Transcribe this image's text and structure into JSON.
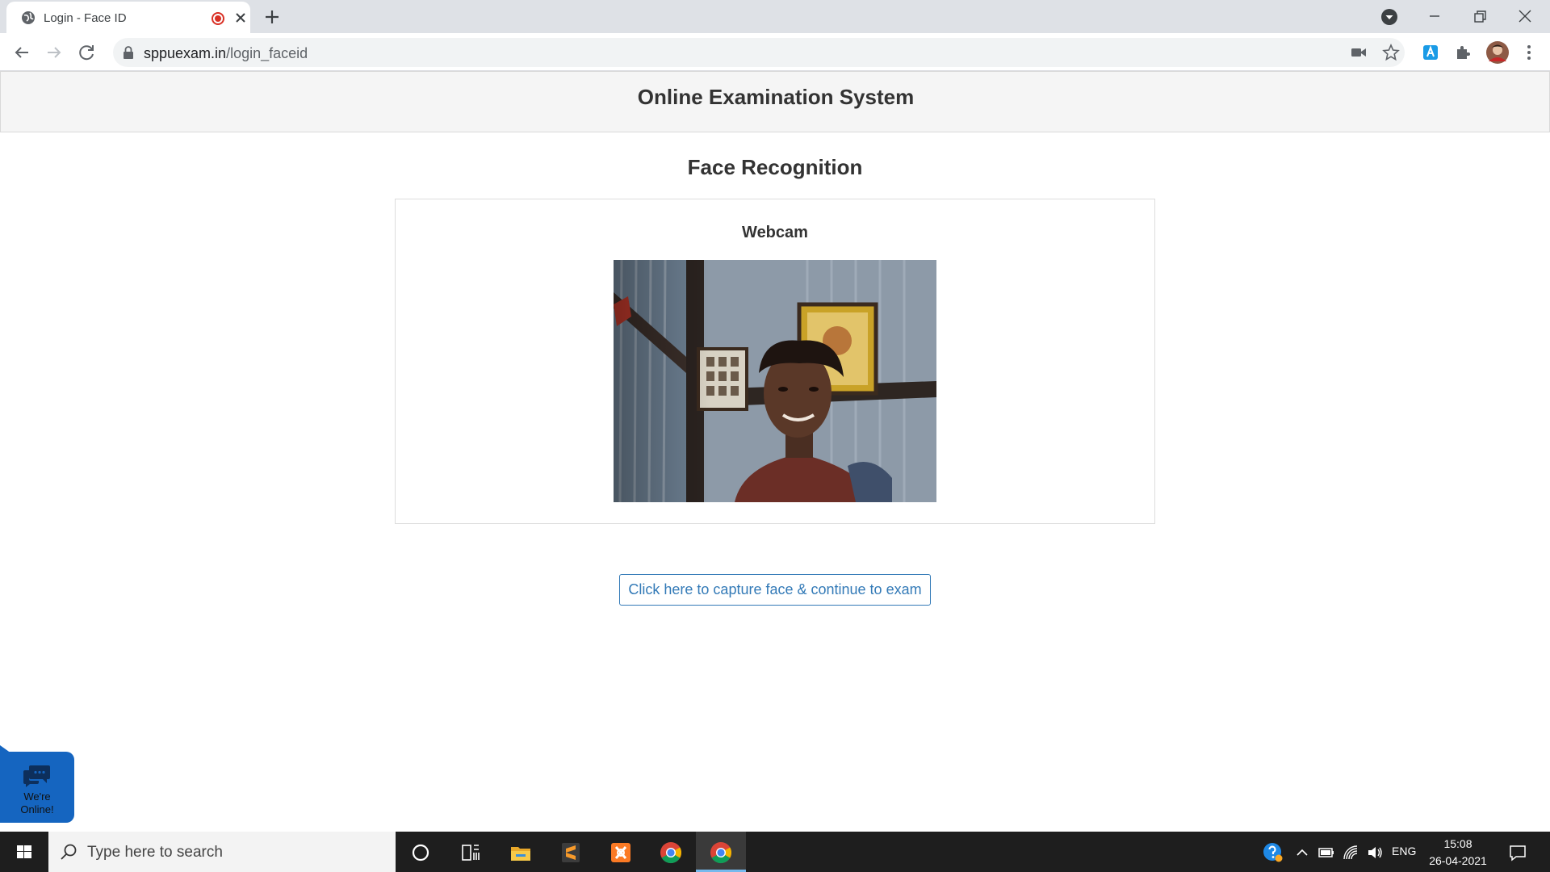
{
  "browser": {
    "tab_title": "Login - Face ID",
    "url_domain": "sppuexam.in",
    "url_path": "/login_faceid"
  },
  "page": {
    "site_title": "Online Examination System",
    "section_title": "Face Recognition",
    "webcam_title": "Webcam",
    "capture_button": "Click here to capture face & continue to exam"
  },
  "chat_widget": {
    "line1": "We're",
    "line2": "Online!"
  },
  "taskbar": {
    "search_placeholder": "Type here to search",
    "apps": [
      "cortana-icon",
      "task-view-icon",
      "file-explorer-icon",
      "sublime-text-icon",
      "xampp-icon",
      "chrome-icon",
      "chrome-icon"
    ],
    "language": "ENG",
    "time": "15:08",
    "date": "26-04-2021"
  },
  "colors": {
    "link_blue": "#337ab7",
    "chat_blue": "#1565c0",
    "header_bg": "#f5f5f5"
  }
}
